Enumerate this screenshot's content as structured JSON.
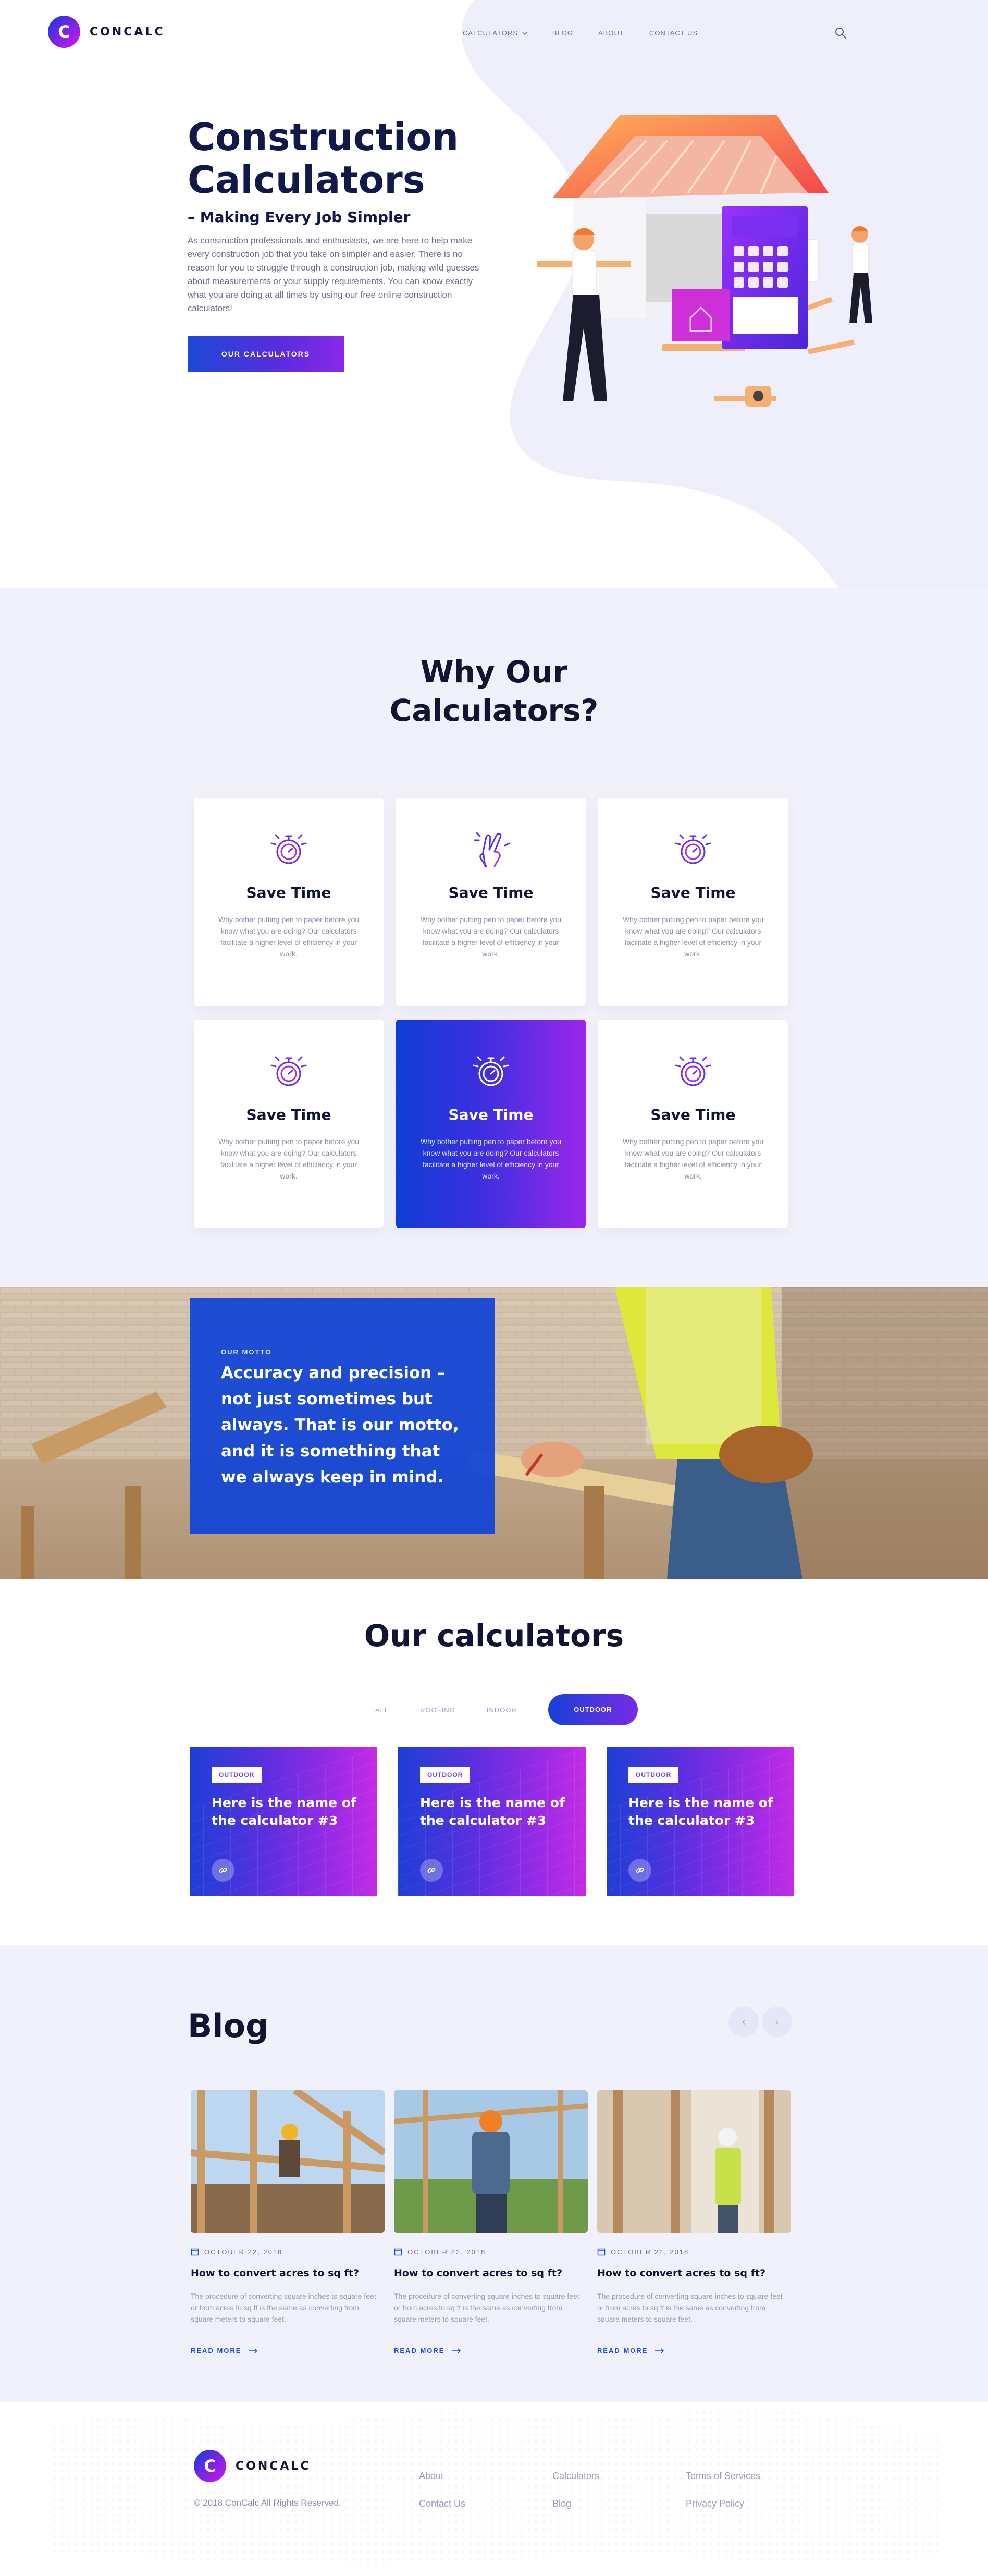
{
  "brand": {
    "name": "CONCALC",
    "mark": "C"
  },
  "colors": {
    "primary": "#1c4ad6",
    "accent": "#8a2ae6",
    "heading": "#13184a",
    "section_bg": "#f1f1fb"
  },
  "nav": {
    "items": [
      {
        "label": "CALCULATORS",
        "has_dropdown": true
      },
      {
        "label": "BLOG"
      },
      {
        "label": "ABOUT"
      },
      {
        "label": "CONTACT US"
      }
    ],
    "search_icon": "search-icon"
  },
  "hero": {
    "title_line1": "Construction",
    "title_line2": "Calculators",
    "subtitle": "– Making Every Job Simpler",
    "description": "As construction professionals and enthusiasts, we are here to help make every construction job that you take on simpler and easier. There is no reason for you to struggle through a construction job, making wild guesses about measurements or your supply requirements. You can know exactly what you are doing at all times by using our free online construction calculators!",
    "cta": "OUR CALCULATORS"
  },
  "why": {
    "title_line1": "Why Our",
    "title_line2": "Calculators?",
    "cards": [
      {
        "icon": "stopwatch-icon",
        "title": "Save Time",
        "text": "Why bother putting pen to paper before you know what you are doing? Our calculators facilitate a higher level of efficiency in your work."
      },
      {
        "icon": "fingers-crossed-icon",
        "title": "Save Time",
        "text": "Why bother putting pen to paper before you know what you are doing? Our calculators facilitate a higher level of efficiency in your work."
      },
      {
        "icon": "stopwatch-icon",
        "title": "Save Time",
        "text": "Why bother putting pen to paper before you know what you are doing? Our calculators facilitate a higher level of efficiency in your work."
      },
      {
        "icon": "stopwatch-icon",
        "title": "Save Time",
        "text": "Why bother putting pen to paper before you know what you are doing? Our calculators facilitate a higher level of efficiency in your work."
      },
      {
        "icon": "stopwatch-icon",
        "title": "Save Time",
        "text": "Why bother putting pen to paper before you know what you are doing? Our calculators facilitate a higher level of efficiency in your work.",
        "active": true
      },
      {
        "icon": "stopwatch-icon",
        "title": "Save Time",
        "text": "Why bother putting pen to paper before you know what you are doing? Our calculators facilitate a higher level of efficiency in your work."
      }
    ]
  },
  "motto": {
    "label": "OUR MOTTO",
    "text": "Accuracy and precision – not just sometimes but always. That is our motto, and it is something that we always keep in mind."
  },
  "calculators": {
    "title": "Our calculators",
    "filters": [
      {
        "label": "ALL"
      },
      {
        "label": "ROOFING"
      },
      {
        "label": "INDOOR"
      },
      {
        "label": "OUTDOOR",
        "active": true
      }
    ],
    "items": [
      {
        "tag": "OUTDOOR",
        "name": "Here is the name of the calculator #3",
        "icon": "link-icon"
      },
      {
        "tag": "OUTDOOR",
        "name": "Here is the name of the calculator #3",
        "icon": "link-icon"
      },
      {
        "tag": "OUTDOOR",
        "name": "Here is the name of the calculator #3",
        "icon": "link-icon"
      }
    ]
  },
  "blog": {
    "title": "Blog",
    "prev_icon": "chevron-left-icon",
    "next_icon": "chevron-right-icon",
    "prev_glyph": "‹",
    "next_glyph": "›",
    "posts": [
      {
        "date": "OCTOBER 22, 2018",
        "title": "How to convert acres to sq ft?",
        "desc": "The procedure of converting square inches to square feet or from acres to sq ft is the same as converting from square meters to square feet.",
        "more": "READ MORE"
      },
      {
        "date": "OCTOBER 22, 2018",
        "title": "How to convert acres to sq ft?",
        "desc": "The procedure of converting square inches to square feet or from acres to sq ft is the same as converting from square meters to square feet.",
        "more": "READ MORE"
      },
      {
        "date": "OCTOBER 22, 2018",
        "title": "How to convert acres to sq ft?",
        "desc": "The procedure of converting square inches to square feet or from acres to sq ft is the same as converting from square meters to square feet.",
        "more": "READ MORE"
      }
    ]
  },
  "footer": {
    "copyright": "© 2018 ConCalc All Rights Reserved.",
    "col1": [
      "About",
      "Contact Us"
    ],
    "col2": [
      "Calculators",
      "Blog"
    ],
    "col3": [
      "Terms of Services",
      "Privacy Policy"
    ]
  }
}
